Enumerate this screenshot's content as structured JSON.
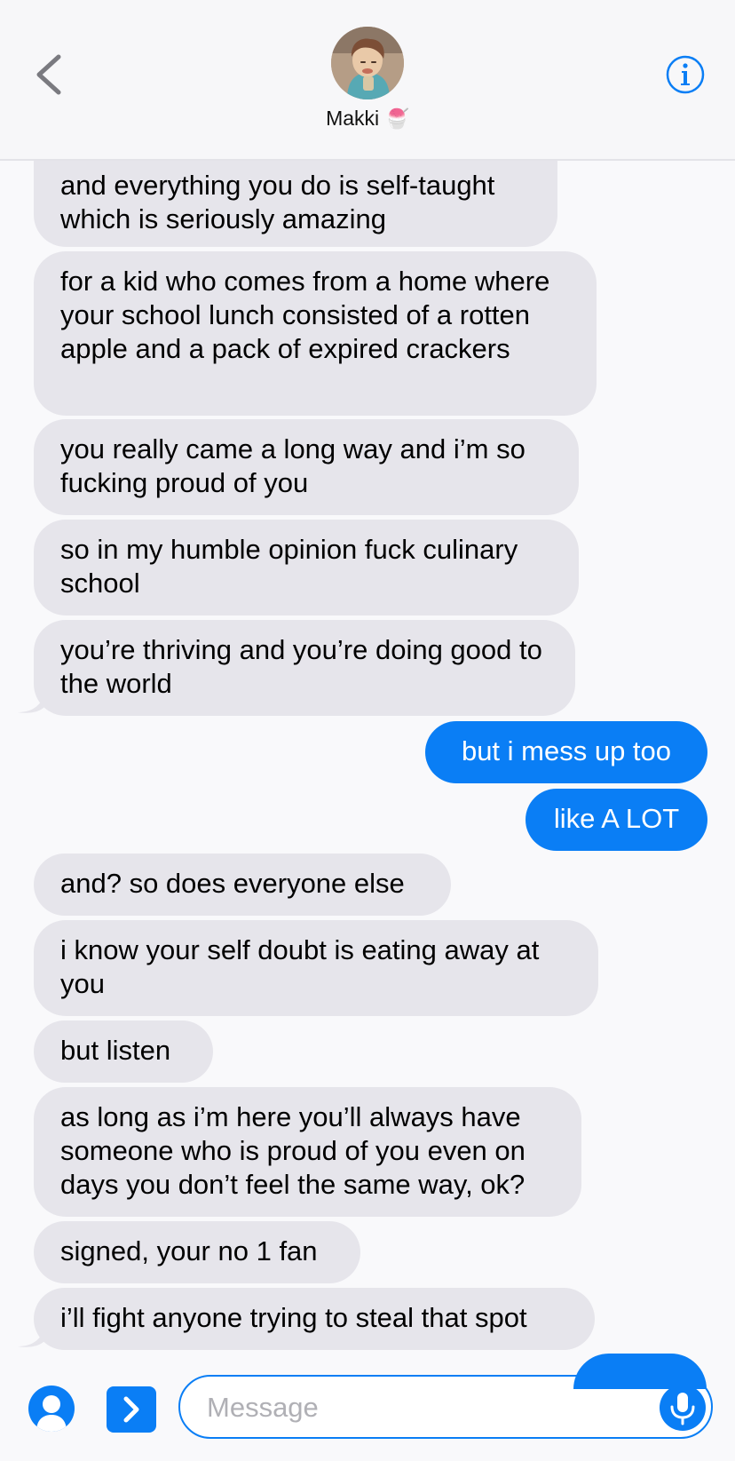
{
  "header": {
    "contact_name": "Makki",
    "contact_emoji": "🍧",
    "back_icon": "chevron-left-icon",
    "info_icon": "info-icon"
  },
  "messages": [
    {
      "side": "in",
      "text": "and everything you do is self-taught which is seriously amazing"
    },
    {
      "side": "in",
      "text": "for a kid who comes from a home where your school lunch consisted of a rotten apple and a pack of expired crackers"
    },
    {
      "side": "in",
      "text": "you really came a long way and i’m so fucking proud of you"
    },
    {
      "side": "in",
      "text": "so in my humble opinion fuck culinary school"
    },
    {
      "side": "in",
      "text": "you’re thriving and you’re doing good to the world"
    },
    {
      "side": "out",
      "text": "but i mess up too"
    },
    {
      "side": "out",
      "text": "like A LOT"
    },
    {
      "side": "in",
      "text": "and? so does everyone else"
    },
    {
      "side": "in",
      "text": "i know your self doubt is eating away at you"
    },
    {
      "side": "in",
      "text": "but listen"
    },
    {
      "side": "in",
      "text": "as long as i’m here you’ll always have someone who is proud of you even on days you don’t feel the same way, ok?"
    },
    {
      "side": "in",
      "text": "signed, your no 1 fan"
    },
    {
      "side": "in",
      "text": "i’ll fight anyone trying to steal that spot"
    }
  ],
  "input_bar": {
    "placeholder": "Message",
    "value": "",
    "contact_icon": "person-icon",
    "apps_icon": "chevron-right-icon",
    "mic_icon": "microphone-icon"
  },
  "colors": {
    "outgoing_bubble": "#0a7ef5",
    "incoming_bubble": "#e6e5eb",
    "accent": "#0a7ef5"
  }
}
